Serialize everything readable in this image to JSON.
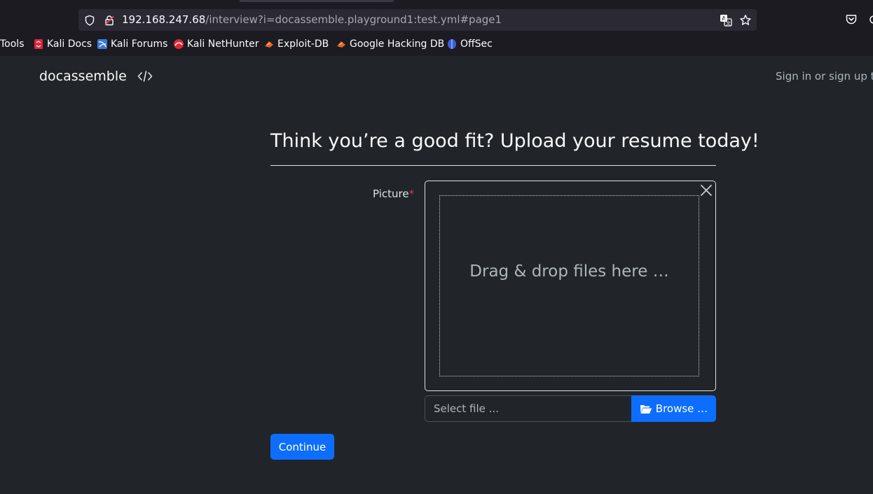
{
  "browser": {
    "url_host": "192.168.247.68",
    "url_path": "/interview?i=docassemble.playground1:test.yml#page1"
  },
  "bookmarks": [
    {
      "label": "Tools",
      "icon": "none"
    },
    {
      "label": "Kali Docs",
      "icon": "kali-docs-icon"
    },
    {
      "label": "Kali Forums",
      "icon": "kali-forums-icon"
    },
    {
      "label": "Kali NetHunter",
      "icon": "kali-nethunter-icon"
    },
    {
      "label": "Exploit-DB",
      "icon": "exploit-db-icon"
    },
    {
      "label": "Google Hacking DB",
      "icon": "exploit-db-icon"
    },
    {
      "label": "OffSec",
      "icon": "offsec-icon"
    }
  ],
  "navbar": {
    "brand": "docassemble",
    "signin": "Sign in or sign up to"
  },
  "question": {
    "title": "Think you’re a good fit? Upload your resume today!",
    "field_label": "Picture",
    "required_marker": "*",
    "drop_text": "Drag & drop files here …",
    "file_placeholder": "Select file ...",
    "browse_label": "Browse …",
    "continue_label": "Continue"
  },
  "colors": {
    "page_background": "#212529",
    "primary": "#0d6efd",
    "required": "#dc3545"
  }
}
